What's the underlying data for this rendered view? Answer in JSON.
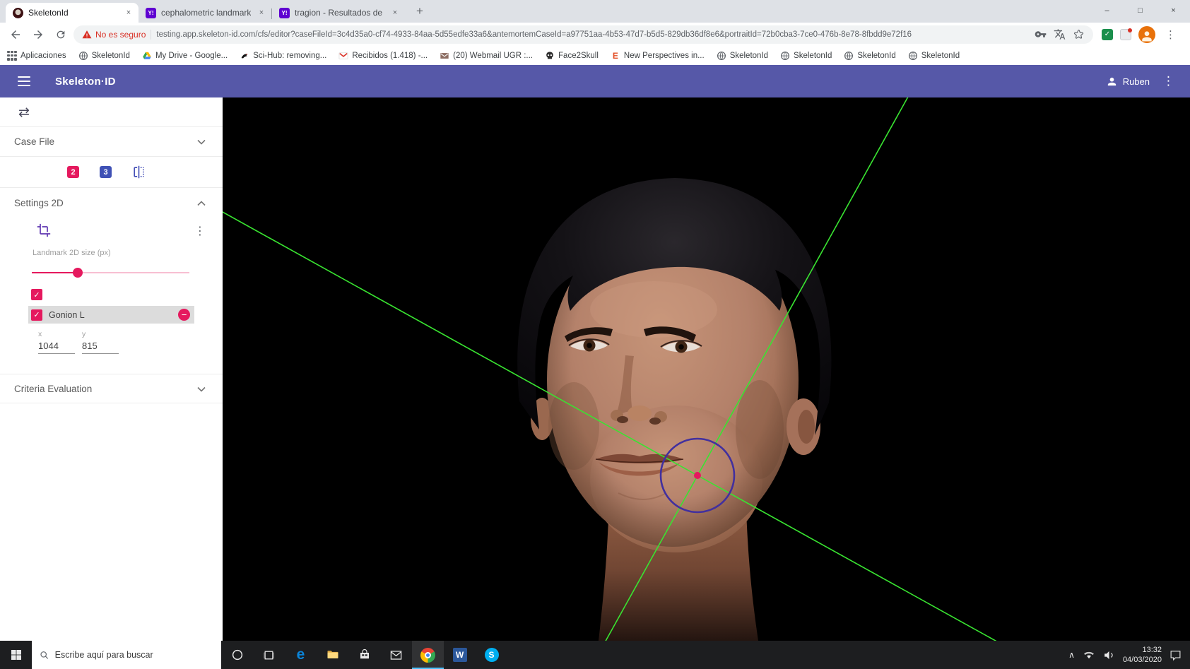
{
  "colors": {
    "header_purple": "#5658a8",
    "accent_pink": "#e5195e",
    "accent_indigo": "#3f51b5",
    "crop_purple": "#5e35b1",
    "line_green": "#39e431",
    "marker_circle_purple": "#42309e",
    "security_red": "#d93025"
  },
  "glyphs": {
    "minimize": "–",
    "maximize": "□",
    "close": "×",
    "tab_close": "×",
    "new_tab": "+",
    "kebab": "⋮",
    "swap": "⇄",
    "check": "✓",
    "minus": "−",
    "caret_up": "∧",
    "edge_letter": "e",
    "word_letter": "W",
    "skype_letter": "S",
    "elsevier_letter": "E",
    "yahoo_glyph": "Y!"
  },
  "browser": {
    "tabs": [
      {
        "title": "SkeletonId"
      },
      {
        "title": "cephalometric landmarks in obli"
      },
      {
        "title": "tragion - Resultados de Yahoo Es"
      }
    ],
    "omnibox": {
      "security_chip": "No es seguro",
      "url": "testing.app.skeleton-id.com/cfs/editor?caseFileId=3c4d35a0-cf74-4933-84aa-5d55edfe33a6&antemortemCaseId=a97751aa-4b53-47d7-b5d5-829db36df8e6&portraitId=72b0cba3-7ce0-476b-8e78-8fbdd9e72f16"
    },
    "bookmarks": [
      {
        "label": "Aplicaciones"
      },
      {
        "label": "SkeletonId"
      },
      {
        "label": "My Drive - Google..."
      },
      {
        "label": "Sci-Hub: removing..."
      },
      {
        "label": "Recibidos (1.418) -..."
      },
      {
        "label": "(20) Webmail UGR :..."
      },
      {
        "label": "Face2Skull"
      },
      {
        "label": "New Perspectives in..."
      },
      {
        "label": "SkeletonId"
      },
      {
        "label": "SkeletonId"
      },
      {
        "label": "SkeletonId"
      },
      {
        "label": "SkeletonId"
      }
    ]
  },
  "app_header": {
    "title": "Skeleton·ID",
    "user_name": "Ruben"
  },
  "sidebar": {
    "case_file_label": "Case File",
    "badge_2": "2",
    "badge_3": "3",
    "settings_2d_label": "Settings 2D",
    "landmark_size_label": "Landmark 2D size (px)",
    "landmark_name": "Gonion L",
    "coord_x_label": "x",
    "coord_x_value": "1044",
    "coord_y_label": "y",
    "coord_y_value": "815",
    "criteria_label": "Criteria Evaluation"
  },
  "taskbar": {
    "search_placeholder": "Escribe aquí para buscar",
    "time": "13:32",
    "date": "04/03/2020"
  }
}
